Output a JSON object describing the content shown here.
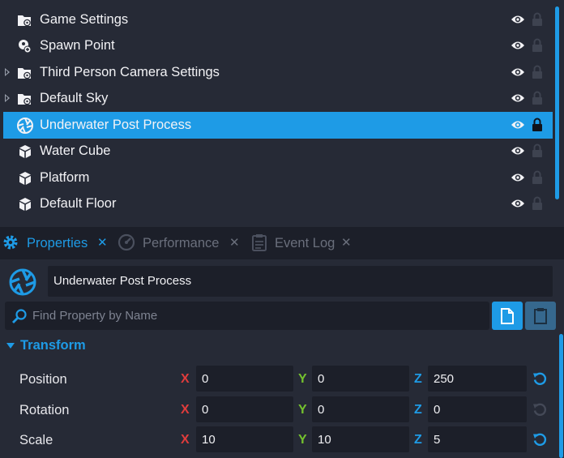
{
  "hierarchy": {
    "items": [
      {
        "label": "Game Settings",
        "icon": "folder-gear-icon",
        "expandable": false,
        "selected": false
      },
      {
        "label": "Spawn Point",
        "icon": "spawn-point-icon",
        "expandable": false,
        "selected": false
      },
      {
        "label": "Third Person Camera Settings",
        "icon": "folder-gear-icon",
        "expandable": true,
        "selected": false
      },
      {
        "label": "Default Sky",
        "icon": "folder-gear-icon",
        "expandable": true,
        "selected": false
      },
      {
        "label": "Underwater Post Process",
        "icon": "post-process-icon",
        "expandable": false,
        "selected": true
      },
      {
        "label": "Water Cube",
        "icon": "cube-icon",
        "expandable": false,
        "selected": false
      },
      {
        "label": "Platform",
        "icon": "cube-icon",
        "expandable": false,
        "selected": false
      },
      {
        "label": "Default Floor",
        "icon": "cube-icon",
        "expandable": false,
        "selected": false
      }
    ]
  },
  "tabs": [
    {
      "label": "Properties",
      "close": "✕",
      "active": true,
      "icon": "gear-icon"
    },
    {
      "label": "Performance",
      "close": "✕",
      "active": false,
      "icon": "gauge-icon"
    },
    {
      "label": "Event Log",
      "close": "✕",
      "active": false,
      "icon": "clipboard-icon"
    }
  ],
  "properties": {
    "object_name": "Underwater Post Process",
    "search_placeholder": "Find Property by Name",
    "section_title": "Transform",
    "axis_labels": {
      "x": "X",
      "y": "Y",
      "z": "Z"
    },
    "rows": [
      {
        "label": "Position",
        "x": "0",
        "y": "0",
        "z": "250",
        "reset_active": true
      },
      {
        "label": "Rotation",
        "x": "0",
        "y": "0",
        "z": "0",
        "reset_active": false
      },
      {
        "label": "Scale",
        "x": "10",
        "y": "10",
        "z": "5",
        "reset_active": true
      }
    ]
  },
  "colors": {
    "accent": "#1e9be6",
    "background": "#262a36",
    "field": "#1c1f29",
    "axis_x": "#e03c3c",
    "axis_y": "#74c22e",
    "axis_z": "#1e9be6"
  }
}
